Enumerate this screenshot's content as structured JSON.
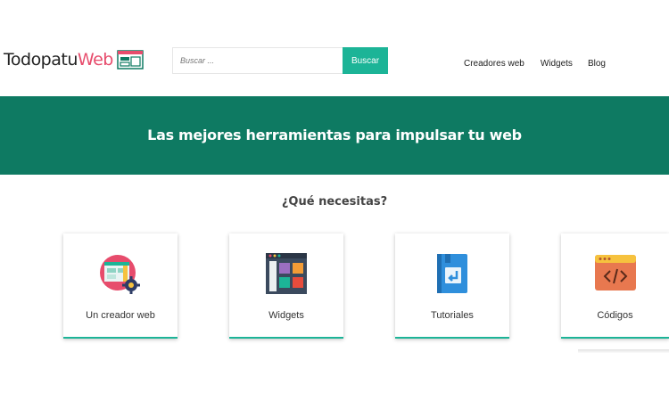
{
  "logo": {
    "text_main": "Todopatu",
    "text_accent": "Web"
  },
  "search": {
    "placeholder": "Buscar ...",
    "button_label": "Buscar"
  },
  "nav": {
    "items": [
      "Creadores web",
      "Widgets",
      "Blog"
    ]
  },
  "hero": {
    "title": "Las mejores herramientas para impulsar tu web"
  },
  "section": {
    "title": "¿Qué necesitas?"
  },
  "cards": [
    {
      "label": "Un creador web",
      "icon": "web-builder-gear-icon"
    },
    {
      "label": "Widgets",
      "icon": "widgets-grid-icon"
    },
    {
      "label": "Tutoriales",
      "icon": "tutorial-book-icon"
    },
    {
      "label": "Códigos",
      "icon": "code-window-icon"
    }
  ],
  "colors": {
    "brand_green": "#0e7a62",
    "accent_teal": "#1cb497",
    "logo_pink": "#e74c6c"
  }
}
